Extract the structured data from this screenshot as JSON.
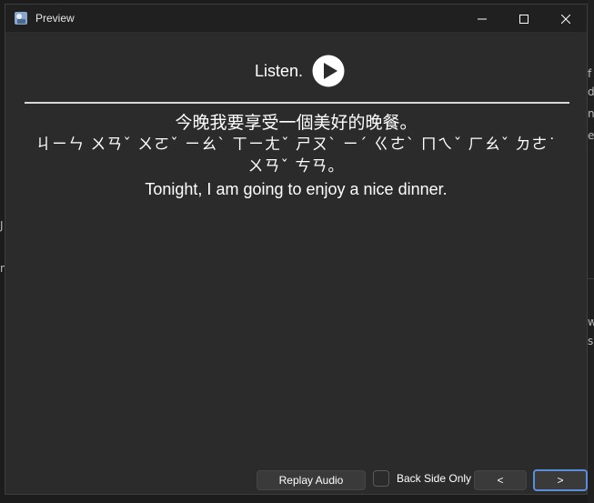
{
  "background_app": {
    "right_snippets": [
      "f",
      "d",
      "n",
      "e"
    ],
    "right_snippets_lower": [
      "w",
      "sp"
    ],
    "left_snippets": [
      "J",
      "n"
    ]
  },
  "window": {
    "title": "Preview",
    "controls": {
      "minimize": "minimize-icon",
      "maximize": "maximize-icon",
      "close": "close-icon"
    }
  },
  "card": {
    "listen_label": "Listen.",
    "play_icon": "play-icon",
    "hanzi": "今晚我要享受一個美好的晚餐。",
    "bopomofo": "ㄐㄧㄣ ㄨㄢˇ ㄨㄛˇ ㄧㄠˋ ㄒㄧㄤˇ ㄕㄡˋ ㄧˊ ㄍㄜˋ ㄇㄟˇ ㄏㄠˇ ㄉㄜ˙ ㄨㄢˇ ㄘㄢ。",
    "english": "Tonight, I am going to enjoy a nice dinner."
  },
  "bottom_bar": {
    "replay_label": "Replay Audio",
    "back_side_only_label": "Back Side Only",
    "back_side_only_checked": false,
    "prev_label": "<",
    "next_label": ">"
  },
  "colors": {
    "window_bg": "#2b2b2b",
    "titlebar_bg": "#202020",
    "focus_accent": "#5a8fd8"
  }
}
